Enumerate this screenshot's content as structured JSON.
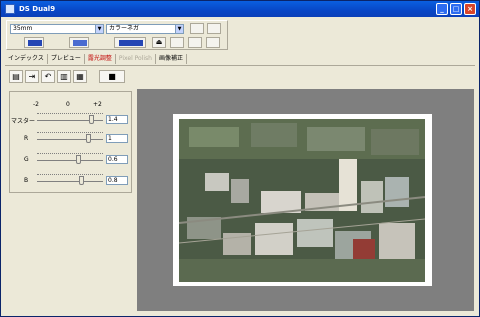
{
  "window": {
    "title": "DS Dual9"
  },
  "toolbar": {
    "film_size": "35mm",
    "film_type": "カラーネガ"
  },
  "tabs": [
    {
      "label": "インデックス"
    },
    {
      "label": "プレビュー"
    },
    {
      "label": "露光調整"
    },
    {
      "label": "Pixel Polish"
    },
    {
      "label": "画像補正"
    }
  ],
  "exposure": {
    "scale_min": "-2",
    "scale_mid": "0",
    "scale_max": "+2",
    "rows": [
      {
        "label": "マスター",
        "value": "1.4"
      },
      {
        "label": "R",
        "value": "1"
      },
      {
        "label": "G",
        "value": "0.6"
      },
      {
        "label": "B",
        "value": "0.8"
      }
    ]
  }
}
